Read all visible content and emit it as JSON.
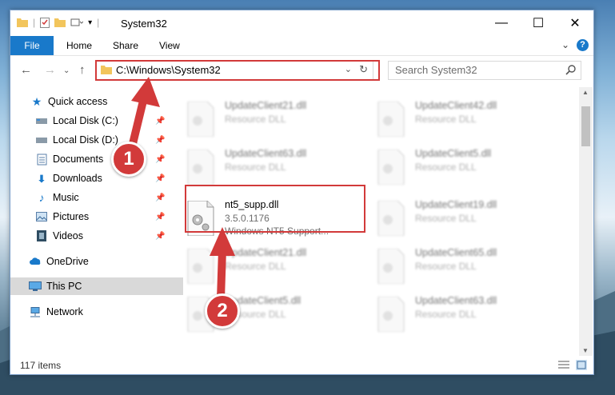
{
  "window": {
    "title": "System32",
    "ribbon_tabs": [
      "File",
      "Home",
      "Share",
      "View"
    ],
    "help_label": "?"
  },
  "address": {
    "path": "C:\\Windows\\System32",
    "search_placeholder": "Search System32"
  },
  "sidebar": {
    "items": [
      {
        "label": "Quick access",
        "icon": "star-icon"
      },
      {
        "label": "Local Disk (C:)",
        "icon": "drive-icon",
        "pinned": true
      },
      {
        "label": "Local Disk (D:)",
        "icon": "drive-icon",
        "pinned": true
      },
      {
        "label": "Documents",
        "icon": "documents-icon",
        "pinned": true
      },
      {
        "label": "Downloads",
        "icon": "download-icon",
        "pinned": true
      },
      {
        "label": "Music",
        "icon": "music-icon",
        "pinned": true
      },
      {
        "label": "Pictures",
        "icon": "pictures-icon",
        "pinned": true
      },
      {
        "label": "Videos",
        "icon": "videos-icon",
        "pinned": true
      },
      {
        "label": "OneDrive",
        "icon": "cloud-icon"
      },
      {
        "label": "This PC",
        "icon": "pc-icon",
        "selected": true
      },
      {
        "label": "Network",
        "icon": "network-icon"
      }
    ]
  },
  "files": {
    "left": [
      {
        "name": "UpdateClient21.dll",
        "type": "Resource DLL"
      },
      {
        "name": "UpdateClient63.dll",
        "type": "Resource DLL"
      },
      {
        "name": "nt5_supp.dll",
        "version": "3.5.0.1176",
        "desc": "Windows NT5 Support..."
      },
      {
        "name": "UpdateClient21.dll",
        "type": "Resource DLL"
      },
      {
        "name": "UpdateClient5.dll",
        "type": "Resource DLL"
      }
    ],
    "right": [
      {
        "name": "UpdateClient42.dll",
        "type": "Resource DLL"
      },
      {
        "name": "UpdateClient5.dll",
        "type": "Resource DLL"
      },
      {
        "name": "UpdateClient19.dll",
        "type": "Resource DLL"
      },
      {
        "name": "UpdateClient65.dll",
        "type": "Resource DLL"
      },
      {
        "name": "UpdateClient63.dll",
        "type": "Resource DLL"
      }
    ]
  },
  "status": {
    "item_count": "117 items"
  },
  "annotations": {
    "step1": "1",
    "step2": "2"
  },
  "colors": {
    "accent": "#1979ca",
    "highlight": "#d23a3a"
  }
}
